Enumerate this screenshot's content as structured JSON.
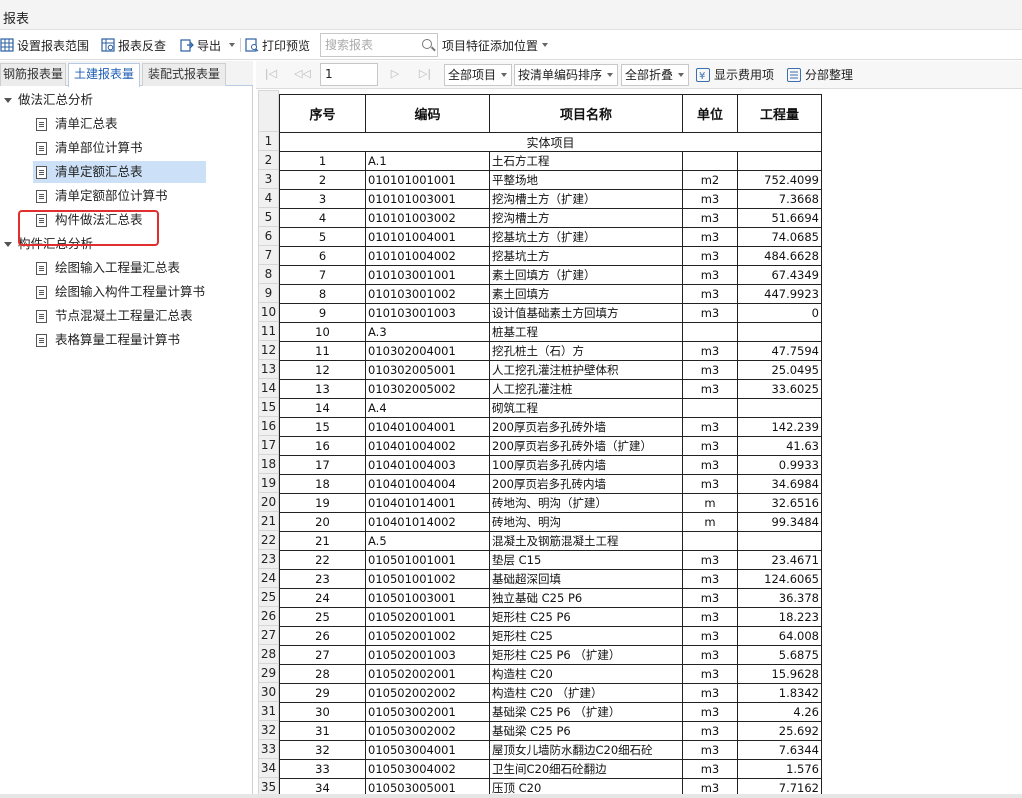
{
  "window": {
    "title": "报表"
  },
  "toolbar": {
    "set_range": "设置报表范围",
    "report_check": "报表反查",
    "export": "导出",
    "print_preview": "打印预览",
    "search_placeholder": "搜索报表",
    "feature_position": "项目特征添加位置"
  },
  "tabs": [
    {
      "label": "钢筋报表量",
      "active": false
    },
    {
      "label": "土建报表量",
      "active": true
    },
    {
      "label": "装配式报表量",
      "active": false
    }
  ],
  "tree": {
    "group1": {
      "label": "做法汇总分析",
      "items": [
        "清单汇总表",
        "清单部位计算书",
        "清单定额汇总表",
        "清单定额部位计算书",
        "构件做法汇总表"
      ]
    },
    "group2": {
      "label": "构件汇总分析",
      "items": [
        "绘图输入工程量汇总表",
        "绘图输入构件工程量计算书",
        "节点混凝土工程量汇总表",
        "表格算量工程量计算书"
      ]
    },
    "selected": "清单定额汇总表"
  },
  "report_toolbar": {
    "page": "1",
    "scope": "全部项目",
    "sort": "按清单编码排序",
    "fold": "全部折叠",
    "show_fee": "显示费用项",
    "tidy": "分部整理"
  },
  "table": {
    "headers": [
      "序号",
      "编码",
      "项目名称",
      "单位",
      "工程量"
    ],
    "section_title": "实体项目",
    "rows": [
      [
        "1",
        "A.1",
        "土石方工程",
        "",
        ""
      ],
      [
        "2",
        "010101001001",
        "平整场地",
        "m2",
        "752.4099"
      ],
      [
        "3",
        "010101003001",
        "挖沟槽土方（扩建）",
        "m3",
        "7.3668"
      ],
      [
        "4",
        "010101003002",
        "挖沟槽土方",
        "m3",
        "51.6694"
      ],
      [
        "5",
        "010101004001",
        "挖基坑土方（扩建）",
        "m3",
        "74.0685"
      ],
      [
        "6",
        "010101004002",
        "挖基坑土方",
        "m3",
        "484.6628"
      ],
      [
        "7",
        "010103001001",
        "素土回填方（扩建）",
        "m3",
        "67.4349"
      ],
      [
        "8",
        "010103001002",
        "素土回填方",
        "m3",
        "447.9923"
      ],
      [
        "9",
        "010103001003",
        "设计值基础素土方回填方",
        "m3",
        "0"
      ],
      [
        "10",
        "A.3",
        "桩基工程",
        "",
        ""
      ],
      [
        "11",
        "010302004001",
        "挖孔桩土（石）方",
        "m3",
        "47.7594"
      ],
      [
        "12",
        "010302005001",
        "人工挖孔灌注桩护壁体积",
        "m3",
        "25.0495"
      ],
      [
        "13",
        "010302005002",
        "人工挖孔灌注桩",
        "m3",
        "33.6025"
      ],
      [
        "14",
        "A.4",
        "砌筑工程",
        "",
        ""
      ],
      [
        "15",
        "010401004001",
        "200厚页岩多孔砖外墙",
        "m3",
        "142.239"
      ],
      [
        "16",
        "010401004002",
        "200厚页岩多孔砖外墙（扩建）",
        "m3",
        "41.63"
      ],
      [
        "17",
        "010401004003",
        "100厚页岩多孔砖内墙",
        "m3",
        "0.9933"
      ],
      [
        "18",
        "010401004004",
        "200厚页岩多孔砖内墙",
        "m3",
        "34.6984"
      ],
      [
        "19",
        "010401014001",
        "砖地沟、明沟（扩建）",
        "m",
        "32.6516"
      ],
      [
        "20",
        "010401014002",
        "砖地沟、明沟",
        "m",
        "99.3484"
      ],
      [
        "21",
        "A.5",
        "混凝土及钢筋混凝土工程",
        "",
        ""
      ],
      [
        "22",
        "010501001001",
        "垫层 C15",
        "m3",
        "23.4671"
      ],
      [
        "23",
        "010501001002",
        "基础超深回填",
        "m3",
        "124.6065"
      ],
      [
        "24",
        "010501003001",
        "独立基础 C25 P6",
        "m3",
        "36.378"
      ],
      [
        "25",
        "010502001001",
        "矩形柱 C25 P6",
        "m3",
        "18.223"
      ],
      [
        "26",
        "010502001002",
        "矩形柱 C25",
        "m3",
        "64.008"
      ],
      [
        "27",
        "010502001003",
        "矩形柱 C25 P6 （扩建）",
        "m3",
        "5.6875"
      ],
      [
        "28",
        "010502002001",
        "构造柱 C20",
        "m3",
        "15.9628"
      ],
      [
        "29",
        "010502002002",
        "构造柱 C20 （扩建）",
        "m3",
        "1.8342"
      ],
      [
        "30",
        "010503002001",
        "基础梁 C25 P6 （扩建）",
        "m3",
        "4.26"
      ],
      [
        "31",
        "010503002002",
        "基础梁 C25 P6",
        "m3",
        "25.692"
      ],
      [
        "32",
        "010503004001",
        "屋顶女儿墙防水翻边C20细石砼",
        "m3",
        "7.6344"
      ],
      [
        "33",
        "010503004002",
        "卫生间C20细石砼翻边",
        "m3",
        "1.576"
      ],
      [
        "34",
        "010503005001",
        "压顶 C20",
        "m3",
        "7.7162"
      ]
    ]
  },
  "row_numbers": [
    "1",
    "2",
    "3",
    "4",
    "5",
    "6",
    "7",
    "8",
    "9",
    "10",
    "11",
    "12",
    "13",
    "14",
    "15",
    "16",
    "17",
    "18",
    "19",
    "20",
    "21",
    "22",
    "23",
    "24",
    "25",
    "26",
    "27",
    "28",
    "29",
    "30",
    "31",
    "32",
    "33",
    "34",
    "35"
  ],
  "colors": {
    "selected_bg": "#cce0f7",
    "highlight_border": "#e0302e",
    "tab_active": "#1f5fb4"
  }
}
